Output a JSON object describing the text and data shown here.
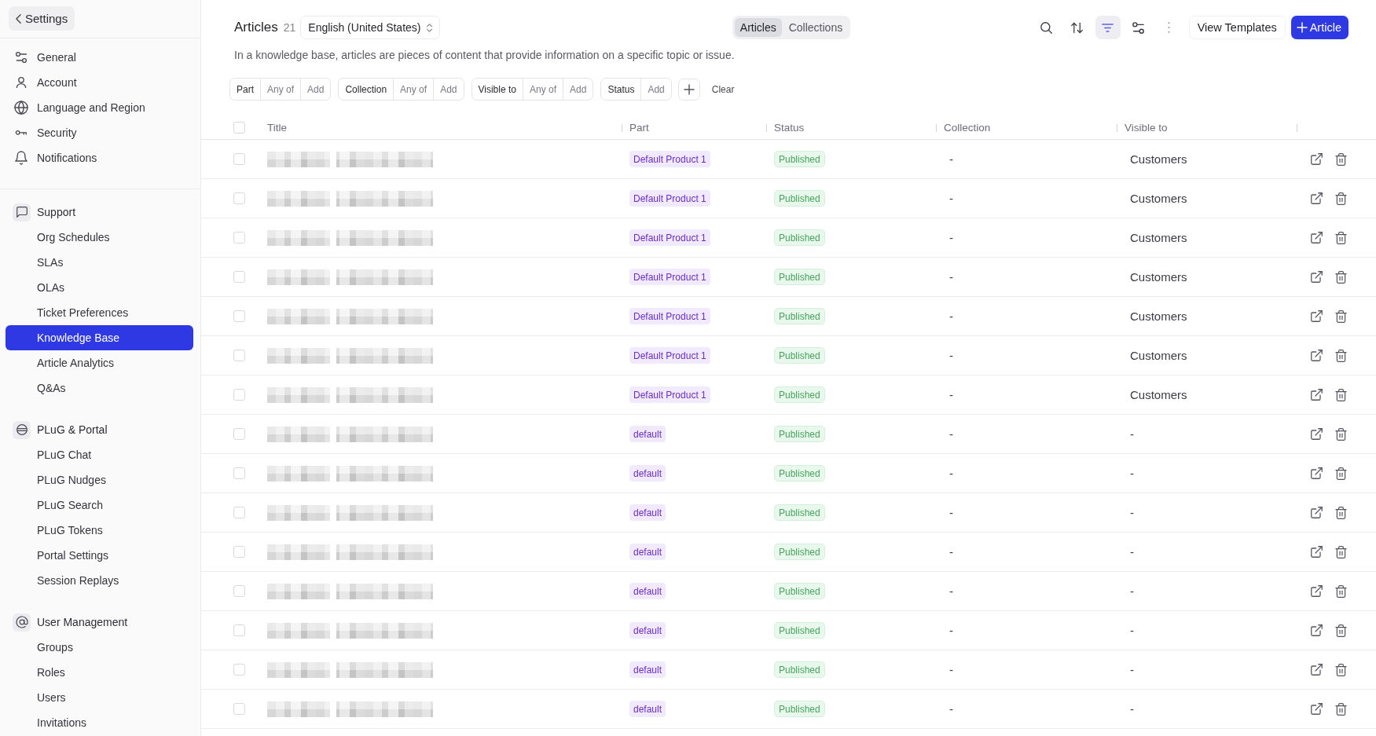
{
  "sidebar": {
    "back_button": "Settings",
    "general_items": [
      {
        "label": "General",
        "selected": false
      },
      {
        "label": "Account",
        "selected": false
      },
      {
        "label": "Language and Region",
        "selected": false
      },
      {
        "label": "Security",
        "selected": false
      },
      {
        "label": "Notifications",
        "selected": false
      }
    ],
    "sections": [
      {
        "title": "Support",
        "items": [
          {
            "label": "Org Schedules",
            "selected": false
          },
          {
            "label": "SLAs",
            "selected": false
          },
          {
            "label": "OLAs",
            "selected": false
          },
          {
            "label": "Ticket Preferences",
            "selected": false
          },
          {
            "label": "Knowledge Base",
            "selected": true
          },
          {
            "label": "Article Analytics",
            "selected": false
          },
          {
            "label": "Q&As",
            "selected": false
          }
        ]
      },
      {
        "title": "PLuG & Portal",
        "items": [
          {
            "label": "PLuG Chat",
            "selected": false
          },
          {
            "label": "PLuG Nudges",
            "selected": false
          },
          {
            "label": "PLuG Search",
            "selected": false
          },
          {
            "label": "PLuG Tokens",
            "selected": false
          },
          {
            "label": "Portal Settings",
            "selected": false
          },
          {
            "label": "Session Replays",
            "selected": false
          }
        ]
      },
      {
        "title": "User Management",
        "items": [
          {
            "label": "Groups",
            "selected": false
          },
          {
            "label": "Roles",
            "selected": false
          },
          {
            "label": "Users",
            "selected": false
          },
          {
            "label": "Invitations",
            "selected": false
          }
        ]
      }
    ]
  },
  "header": {
    "title": "Articles",
    "count": "21",
    "language": "English (United States)",
    "view_tabs": [
      {
        "label": "Articles",
        "selected": true
      },
      {
        "label": "Collections",
        "selected": false
      }
    ],
    "toolbar": [
      {
        "kind": "search",
        "active": false
      },
      {
        "kind": "sort",
        "active": false
      },
      {
        "kind": "filter",
        "active": true
      },
      {
        "kind": "options",
        "active": false
      },
      {
        "kind": "more",
        "active": false
      }
    ],
    "secondary_button": "View Templates",
    "primary_button": "Article"
  },
  "description": "In a knowledge base, articles are pieces of content that provide information on a specific topic or issue.",
  "filters": {
    "chips": [
      {
        "field": "Part",
        "operator": "Any of",
        "add": "Add"
      },
      {
        "field": "Collection",
        "operator": "Any of",
        "add": "Add"
      },
      {
        "field": "Visible to",
        "operator": "Any of",
        "add": "Add"
      },
      {
        "field": "Status",
        "add": "Add"
      }
    ],
    "clear_button": "Clear"
  },
  "table": {
    "select_all_checked": false,
    "columns": [
      "Title",
      "Part",
      "Status",
      "Collection",
      "Visible to"
    ],
    "rows": [
      {
        "checked": false,
        "part": "Default Product 1",
        "status": "Published",
        "collection": "-",
        "visible_to": "Customers"
      },
      {
        "checked": false,
        "part": "Default Product 1",
        "status": "Published",
        "collection": "-",
        "visible_to": "Customers"
      },
      {
        "checked": false,
        "part": "Default Product 1",
        "status": "Published",
        "collection": "-",
        "visible_to": "Customers"
      },
      {
        "checked": false,
        "part": "Default Product 1",
        "status": "Published",
        "collection": "-",
        "visible_to": "Customers"
      },
      {
        "checked": false,
        "part": "Default Product 1",
        "status": "Published",
        "collection": "-",
        "visible_to": "Customers"
      },
      {
        "checked": false,
        "part": "Default Product 1",
        "status": "Published",
        "collection": "-",
        "visible_to": "Customers"
      },
      {
        "checked": false,
        "part": "Default Product 1",
        "status": "Published",
        "collection": "-",
        "visible_to": "Customers"
      },
      {
        "checked": false,
        "part": "default",
        "status": "Published",
        "collection": "-",
        "visible_to": "-"
      },
      {
        "checked": false,
        "part": "default",
        "status": "Published",
        "collection": "-",
        "visible_to": "-"
      },
      {
        "checked": false,
        "part": "default",
        "status": "Published",
        "collection": "-",
        "visible_to": "-"
      },
      {
        "checked": false,
        "part": "default",
        "status": "Published",
        "collection": "-",
        "visible_to": "-"
      },
      {
        "checked": false,
        "part": "default",
        "status": "Published",
        "collection": "-",
        "visible_to": "-"
      },
      {
        "checked": false,
        "part": "default",
        "status": "Published",
        "collection": "-",
        "visible_to": "-"
      },
      {
        "checked": false,
        "part": "default",
        "status": "Published",
        "collection": "-",
        "visible_to": "-"
      },
      {
        "checked": false,
        "part": "default",
        "status": "Published",
        "collection": "-",
        "visible_to": "-"
      }
    ]
  }
}
